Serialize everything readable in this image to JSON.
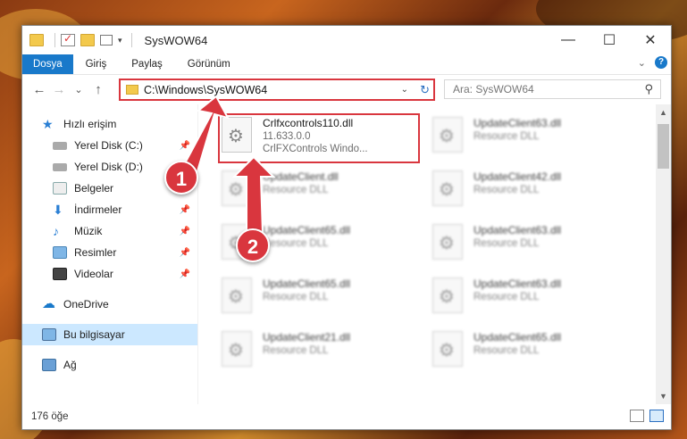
{
  "window": {
    "title": "SysWOW64",
    "controls": {
      "minimize": "—",
      "maximize": "☐",
      "close": "✕"
    }
  },
  "ribbon": {
    "tabs": [
      {
        "label": "Dosya",
        "active": true
      },
      {
        "label": "Giriş"
      },
      {
        "label": "Paylaş"
      },
      {
        "label": "Görünüm"
      }
    ],
    "expand_icon": "chevron-down-icon",
    "help_label": "?"
  },
  "navbar": {
    "back": "←",
    "forward": "→",
    "recent": "⌄",
    "up": "↑",
    "address": "C:\\Windows\\SysWOW64",
    "search_placeholder": "Ara: SysWOW64"
  },
  "sidebar": {
    "items": [
      {
        "label": "Hızlı erişim",
        "icon": "star-icon"
      },
      {
        "label": "Yerel Disk (C:)",
        "icon": "drive-icon",
        "pinned": true
      },
      {
        "label": "Yerel Disk (D:)",
        "icon": "drive-icon",
        "pinned": true
      },
      {
        "label": "Belgeler",
        "icon": "documents-icon",
        "pinned": true
      },
      {
        "label": "İndirmeler",
        "icon": "downloads-icon",
        "pinned": true
      },
      {
        "label": "Müzik",
        "icon": "music-icon",
        "pinned": true
      },
      {
        "label": "Resimler",
        "icon": "pictures-icon",
        "pinned": true
      },
      {
        "label": "Videolar",
        "icon": "videos-icon",
        "pinned": true
      }
    ],
    "onedrive": "OneDrive",
    "this_pc": "Bu bilgisayar",
    "network": "Ağ"
  },
  "files": {
    "highlighted": {
      "name": "Crlfxcontrols110.dll",
      "version": "11.633.0.0",
      "description": "CrlFXControls Windo..."
    },
    "left_column": [
      {
        "name": "UpdateClient.dll",
        "type": "Resource DLL"
      },
      {
        "name": "UpdateClient65.dll",
        "type": "Resource DLL"
      },
      {
        "name": "UpdateClient65.dll",
        "type": "Resource DLL"
      },
      {
        "name": "UpdateClient21.dll",
        "type": "Resource DLL"
      }
    ],
    "right_column": [
      {
        "name": "UpdateClient63.dll",
        "type": "Resource DLL"
      },
      {
        "name": "UpdateClient42.dll",
        "type": "Resource DLL"
      },
      {
        "name": "UpdateClient63.dll",
        "type": "Resource DLL"
      },
      {
        "name": "UpdateClient63.dll",
        "type": "Resource DLL"
      },
      {
        "name": "UpdateClient65.dll",
        "type": "Resource DLL"
      }
    ]
  },
  "status": {
    "item_count": "176 öğe"
  },
  "annotations": {
    "badge1": "1",
    "badge2": "2"
  },
  "colors": {
    "accent": "#1979ca",
    "highlight": "#d9363e",
    "folder": "#f3c94c"
  }
}
